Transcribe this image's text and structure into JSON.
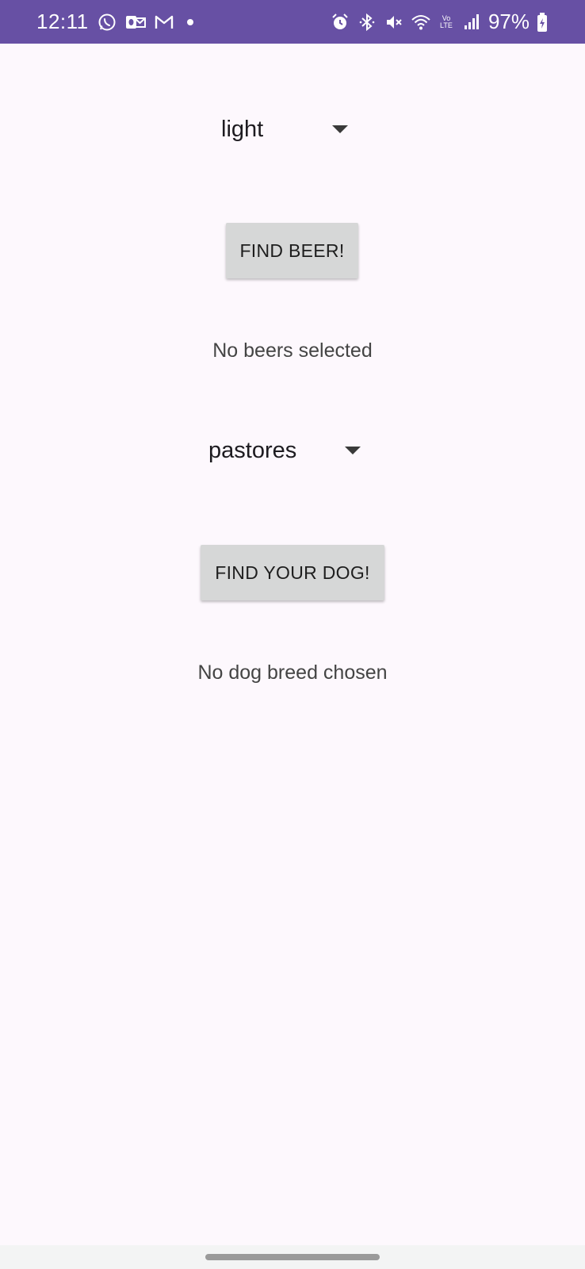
{
  "status_bar": {
    "time": "12:11",
    "battery": "97%",
    "left_icons": [
      "whatsapp-icon",
      "outlook-icon",
      "gmail-icon",
      "notification-dot-icon"
    ],
    "right_icons": [
      "alarm-icon",
      "bluetooth-icon",
      "mute-icon",
      "wifi-icon",
      "volte-icon",
      "signal-icon",
      "battery-charging-icon"
    ],
    "volte_label": "Vo LTE",
    "color": "#6750a4"
  },
  "beer": {
    "selected": "light",
    "button_label": "FIND BEER!",
    "result": "No beers selected"
  },
  "dog": {
    "selected": "pastores",
    "button_label": "FIND YOUR DOG!",
    "result": "No dog breed chosen"
  }
}
